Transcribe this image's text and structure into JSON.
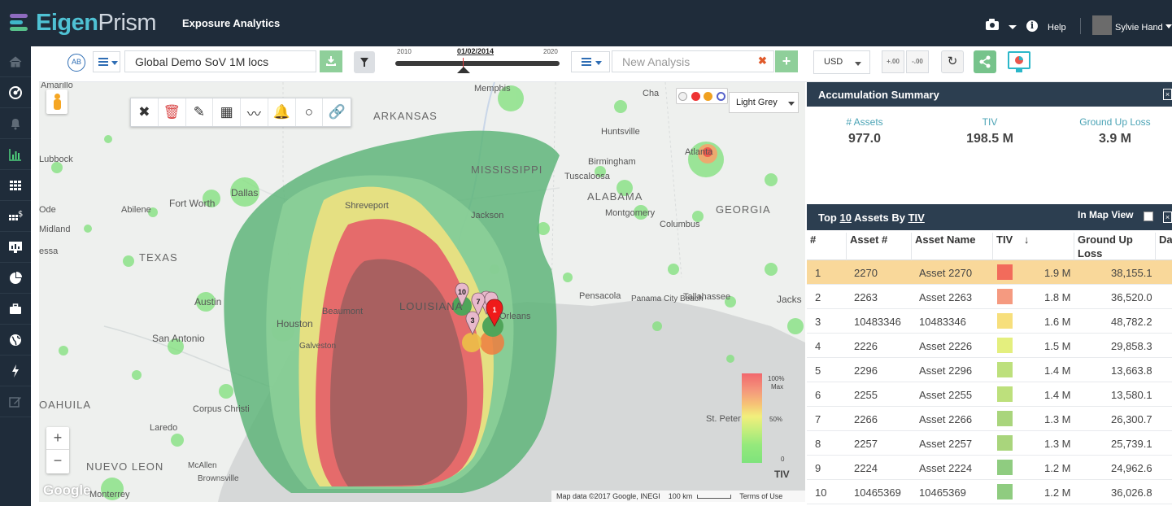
{
  "header": {
    "logo_eigen": "Eigen",
    "logo_prism": "Prism",
    "app_title": "Exposure Analytics",
    "help_label": "Help",
    "user_name": "Sylvie Hand"
  },
  "sidebar": {
    "items": [
      "home-icon",
      "hurricane-icon",
      "bell-icon",
      "bar-chart-icon",
      "grid-icon",
      "dollar-grid-icon",
      "monitor-chart-icon",
      "pie-chart-icon",
      "briefcase-icon",
      "globe-icon",
      "lightning-icon",
      "edit-icon"
    ],
    "active_index": 3
  },
  "toolbar": {
    "ab_label": "AB",
    "portfolio_value": "Global Demo SoV 1M locs",
    "timeline_start": "2010",
    "timeline_end": "2020",
    "timeline_date": "01/02/2014",
    "analysis_placeholder": "New Analysis",
    "currency": "USD",
    "decimal_add_label": "+.00",
    "decimal_remove_label": "-.00"
  },
  "map": {
    "basemap_style": "Light Grey",
    "places": [
      {
        "name": "Amarillo"
      },
      {
        "name": "Lubbock"
      },
      {
        "name": "ARKANSAS"
      },
      {
        "name": "Memphis"
      },
      {
        "name": "Huntsville"
      },
      {
        "name": "MISSISSIPPI"
      },
      {
        "name": "Birmingham"
      },
      {
        "name": "Tuscaloosa"
      },
      {
        "name": "Atlanta"
      },
      {
        "name": "Dallas"
      },
      {
        "name": "Fort Worth"
      },
      {
        "name": "Abilene"
      },
      {
        "name": "Shreveport"
      },
      {
        "name": "ALABAMA"
      },
      {
        "name": "GEORGIA"
      },
      {
        "name": "Jackson"
      },
      {
        "name": "Montgomery"
      },
      {
        "name": "Columbus"
      },
      {
        "name": "Midland"
      },
      {
        "name": "TEXAS"
      },
      {
        "name": "LOUISIANA"
      },
      {
        "name": "Beaumont"
      },
      {
        "name": "Pensacola"
      },
      {
        "name": "Panama City Beach"
      },
      {
        "name": "Tallahassee"
      },
      {
        "name": "Austin"
      },
      {
        "name": "Houston"
      },
      {
        "name": "San Antonio"
      },
      {
        "name": "Galveston"
      },
      {
        "name": "OAHUILA"
      },
      {
        "name": "Corpus Christi"
      },
      {
        "name": "Laredo"
      },
      {
        "name": "NUEVO LEON"
      },
      {
        "name": "Monterrey"
      },
      {
        "name": "Brownsville"
      },
      {
        "name": "McAllen"
      },
      {
        "name": "St. Peter"
      },
      {
        "name": "Jacks"
      },
      {
        "name": "Cha"
      },
      {
        "name": "Ode"
      },
      {
        "name": "essa"
      },
      {
        "name": "Orleans"
      }
    ],
    "markers": [
      "10",
      "7",
      "3",
      "1"
    ],
    "legend": {
      "max_label": "100%",
      "max_sub": "Max",
      "mid_label": "50%",
      "min_label": "0",
      "title": "TIV"
    },
    "attribution": "Map data ©2017 Google, INEGI",
    "scale": "100 km",
    "terms": "Terms of Use",
    "google": "Google"
  },
  "accumulation": {
    "title": "Accumulation Summary",
    "metrics": [
      {
        "label": "# Assets",
        "value": "977.0"
      },
      {
        "label": "TIV",
        "value": "198.5 M"
      },
      {
        "label": "Ground Up Loss",
        "value": "3.9 M"
      }
    ]
  },
  "top_assets": {
    "title_prefix": "Top",
    "count": "10",
    "title_mid": "Assets  By",
    "metric": "TIV",
    "in_map_view": "In Map View",
    "columns": [
      "#",
      "Asset #",
      "Asset Name",
      "TIV",
      "Ground Up Loss",
      "Da"
    ],
    "rows": [
      {
        "n": "1",
        "asset_no": "2270",
        "name": "Asset 2270",
        "color": "#f26b5b",
        "tiv": "1.9 M",
        "loss": "38,155.1"
      },
      {
        "n": "2",
        "asset_no": "2263",
        "name": "Asset 2263",
        "color": "#f59a80",
        "tiv": "1.8 M",
        "loss": "36,520.0"
      },
      {
        "n": "3",
        "asset_no": "10483346",
        "name": "10483346",
        "color": "#f7df7c",
        "tiv": "1.6 M",
        "loss": "48,782.2"
      },
      {
        "n": "4",
        "asset_no": "2226",
        "name": "Asset 2226",
        "color": "#e4ef7e",
        "tiv": "1.5 M",
        "loss": "29,858.3"
      },
      {
        "n": "5",
        "asset_no": "2296",
        "name": "Asset 2296",
        "color": "#bde07c",
        "tiv": "1.4 M",
        "loss": "13,663.8"
      },
      {
        "n": "6",
        "asset_no": "2255",
        "name": "Asset 2255",
        "color": "#bde07c",
        "tiv": "1.4 M",
        "loss": "13,580.1"
      },
      {
        "n": "7",
        "asset_no": "2266",
        "name": "Asset 2266",
        "color": "#a9d57c",
        "tiv": "1.3 M",
        "loss": "26,300.7"
      },
      {
        "n": "8",
        "asset_no": "2257",
        "name": "Asset 2257",
        "color": "#a9d57c",
        "tiv": "1.3 M",
        "loss": "25,739.1"
      },
      {
        "n": "9",
        "asset_no": "2224",
        "name": "Asset 2224",
        "color": "#8fcc80",
        "tiv": "1.2 M",
        "loss": "24,962.6"
      },
      {
        "n": "10",
        "asset_no": "10465369",
        "name": "10465369",
        "color": "#8fcc80",
        "tiv": "1.2 M",
        "loss": "36,026.8"
      }
    ],
    "selected_index": 0
  }
}
